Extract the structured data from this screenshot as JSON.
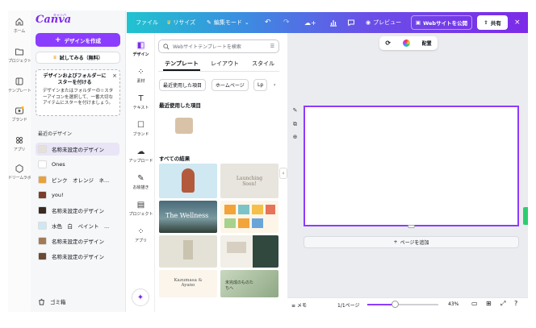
{
  "app": {
    "logo": "Canva",
    "logo_badge": "キャンバ"
  },
  "rail": [
    {
      "label": "ホーム",
      "icon": "home-icon"
    },
    {
      "label": "プロジェクト",
      "icon": "folder-icon"
    },
    {
      "label": "テンプレート",
      "icon": "template-icon"
    },
    {
      "label": "ブランド",
      "icon": "brand-icon"
    },
    {
      "label": "アプリ",
      "icon": "apps-icon"
    },
    {
      "label": "ドリームラボ",
      "icon": "dream-lab-icon"
    }
  ],
  "sidebar": {
    "create_label": "デザインを作成",
    "trial_label": "試してみる（無料）",
    "promo_title": "デザインおよびフォルダーにスターを付ける",
    "promo_body": "デザインまたはフォルダーの☆スターアイコンを選択して、一番大切なアイテムにスターを付けましょう。",
    "promo_close": "×",
    "recent_header": "最近のデザイン",
    "recent": [
      {
        "label": "名称未設定のデザイン",
        "color": "#e5e0d8",
        "selected": true
      },
      {
        "label": "Ones",
        "color": "#ffffff"
      },
      {
        "label": "ピンク　オレンジ　ネ...",
        "color": "#e9a23b"
      },
      {
        "label": "you!",
        "color": "#7a3d2a"
      },
      {
        "label": "名称未設定のデザイン",
        "color": "#3a2a22"
      },
      {
        "label": "水色　白　ペイント　...",
        "color": "#cfe7f2"
      },
      {
        "label": "名称未設定のデザイン",
        "color": "#a37a55"
      },
      {
        "label": "名称未設定のデザイン",
        "color": "#6b4a33"
      }
    ],
    "trash_label": "ゴミ箱"
  },
  "topbar": {
    "file": "ファイル",
    "resize": "リサイズ",
    "edit_mode": "編集モード",
    "preview": "プレビュー",
    "publish": "Webサイトを公開",
    "share": "共有",
    "close": "×"
  },
  "panel_tabs": [
    {
      "label": "デザイン",
      "icon": "design-icon",
      "selected": true
    },
    {
      "label": "素材",
      "icon": "elements-icon"
    },
    {
      "label": "テキスト",
      "icon": "text-icon"
    },
    {
      "label": "ブランド",
      "icon": "brand-icon"
    },
    {
      "label": "アップロード",
      "icon": "upload-icon"
    },
    {
      "label": "お絵描き",
      "icon": "draw-icon"
    },
    {
      "label": "プロジェクト",
      "icon": "projects-icon"
    },
    {
      "label": "アプリ",
      "icon": "apps-icon"
    }
  ],
  "templates_panel": {
    "search_placeholder": "Webサイトテンプレートを検索",
    "tabs": [
      "テンプレート",
      "レイアウト",
      "スタイル"
    ],
    "chips": [
      "最近使用した項目",
      "ホームページ",
      "Lp",
      "›"
    ],
    "recent_section": "最近使用した項目",
    "all_section": "すべての結果",
    "thumb_texts": [
      "Launching Soon!",
      "The Wellness",
      "Kazumasa & Ayano",
      "未完成のものたちへ"
    ],
    "collapse": "‹"
  },
  "canvas": {
    "toolbar_layout": "配置",
    "add_page": "ページを追加",
    "note": "メモ",
    "page_count": "1/1ページ",
    "zoom": "43%"
  },
  "colors": {
    "accent": "#8b3dff",
    "brand_purple": "#7d2ae8",
    "teal": "#20c3cf"
  }
}
